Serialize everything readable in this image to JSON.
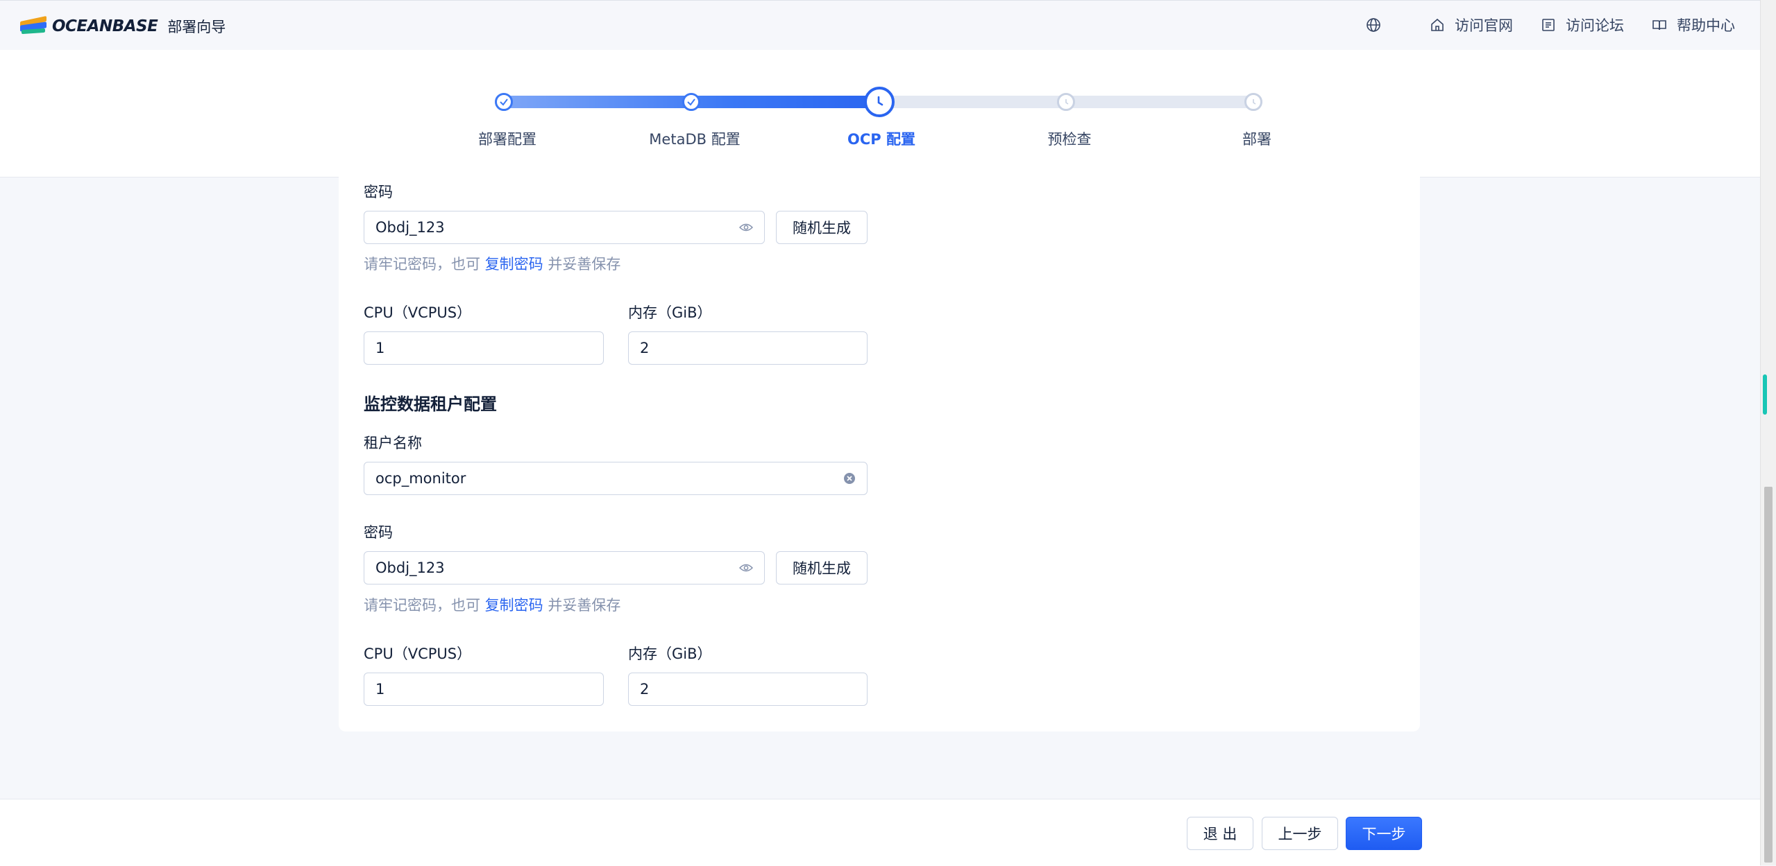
{
  "header": {
    "logo_text": "OCEANBASE",
    "subtitle": "部署向导",
    "nav": [
      {
        "label": "访问官网",
        "icon": "home-icon"
      },
      {
        "label": "访问论坛",
        "icon": "forum-icon"
      },
      {
        "label": "帮助中心",
        "icon": "book-icon"
      }
    ],
    "language_icon": "globe-icon"
  },
  "steps": {
    "items": [
      {
        "label": "部署配置",
        "status": "done"
      },
      {
        "label": "MetaDB 配置",
        "status": "done"
      },
      {
        "label": "OCP 配置",
        "status": "current"
      },
      {
        "label": "预检查",
        "status": "pending"
      },
      {
        "label": "部署",
        "status": "pending"
      }
    ],
    "progress": 0.5,
    "accent_color": "#2a65f0"
  },
  "form": {
    "meta_tenant": {
      "password_label": "密码",
      "password_value": "Obdj_123",
      "random_button": "随机生成",
      "hint_before": "请牢记密码，也可",
      "hint_link": "复制密码",
      "hint_after": "并妥善保存",
      "cpu_label": "CPU（VCPUS）",
      "cpu_value": "1",
      "memory_label": "内存（GiB）",
      "memory_value": "2"
    },
    "monitor_tenant": {
      "section_title": "监控数据租户配置",
      "tenant_name_label": "租户名称",
      "tenant_name_value": "ocp_monitor",
      "password_label": "密码",
      "password_value": "Obdj_123",
      "random_button": "随机生成",
      "hint_before": "请牢记密码，也可",
      "hint_link": "复制密码",
      "hint_after": "并妥善保存",
      "cpu_label": "CPU（VCPUS）",
      "cpu_value": "1",
      "memory_label": "内存（GiB）",
      "memory_value": "2"
    }
  },
  "footer": {
    "exit_label": "退 出",
    "prev_label": "上一步",
    "next_label": "下一步"
  }
}
